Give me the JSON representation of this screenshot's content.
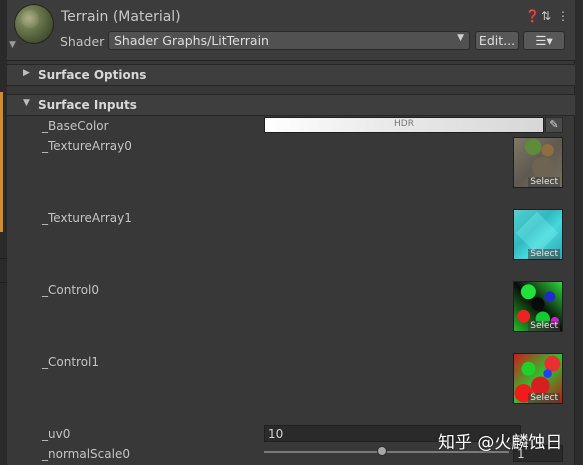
{
  "header": {
    "title": "Terrain (Material)",
    "shader_label": "Shader",
    "shader_value": "Shader Graphs/LitTerrain",
    "edit_label": "Edit...",
    "icons": [
      "help-icon",
      "preset-icon",
      "more-icon",
      "list-icon",
      "dropdown-arrow-icon"
    ]
  },
  "sections": {
    "surface_options": "Surface Options",
    "surface_inputs": "Surface Inputs"
  },
  "properties": {
    "base_color": {
      "label": "_BaseColor",
      "badge": "HDR",
      "color": "#ffffff"
    },
    "texture_array0": {
      "label": "_TextureArray0",
      "select": "Select"
    },
    "texture_array1": {
      "label": "_TextureArray1",
      "select": "Select"
    },
    "control0": {
      "label": "_Control0",
      "select": "Select"
    },
    "control1": {
      "label": "_Control1",
      "select": "Select"
    },
    "uv0": {
      "label": "_uv0",
      "value": "10"
    },
    "normal_scale0": {
      "label": "_normalScale0",
      "value": "1",
      "slider_fraction": 0.48
    }
  },
  "watermark": "知乎 @火麟蚀日"
}
